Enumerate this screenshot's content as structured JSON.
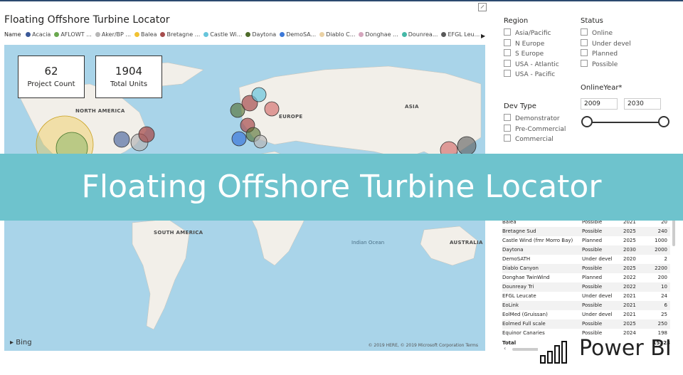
{
  "report": {
    "title": "Floating Offshore Turbine Locator",
    "legend_label": "Name",
    "legend_items": [
      {
        "label": "Acacia",
        "color": "#3b5998"
      },
      {
        "label": "AFLOWT ...",
        "color": "#6aa84f"
      },
      {
        "label": "Aker/BP ...",
        "color": "#b7b7b7"
      },
      {
        "label": "Balea",
        "color": "#f1c232"
      },
      {
        "label": "Bretagne ...",
        "color": "#a64d4d"
      },
      {
        "label": "Castle Wi...",
        "color": "#67c5db"
      },
      {
        "label": "Daytona",
        "color": "#4e6b2a"
      },
      {
        "label": "DemoSA...",
        "color": "#3c78d8"
      },
      {
        "label": "Diablo C...",
        "color": "#ead1a4"
      },
      {
        "label": "Donghae ...",
        "color": "#d5a6bd"
      },
      {
        "label": "Dounrea...",
        "color": "#45b8a7"
      },
      {
        "label": "EFGL Leu...",
        "color": "#595959"
      }
    ],
    "legend_more_icon": "chevron-right-icon",
    "focus_icon": "focus-mode-icon"
  },
  "cards": {
    "project_count": {
      "value": "62",
      "label": "Project Count"
    },
    "total_units": {
      "value": "1904",
      "label": "Total Units"
    }
  },
  "map": {
    "labels": {
      "north_america": "NORTH AMERICA",
      "europe": "EUROPE",
      "asia": "ASIA",
      "south_america": "SOUTH AMERICA",
      "australia": "AUSTRALIA",
      "indian_ocean": "Indian Ocean"
    },
    "bing": "Bing",
    "copyright": "© 2019 HERE, © 2019 Microsoft Corporation  Terms"
  },
  "slicers": {
    "region": {
      "title": "Region",
      "options": [
        "Asia/Pacific",
        "N Europe",
        "S Europe",
        "USA - Atlantic",
        "USA - Pacific"
      ]
    },
    "status": {
      "title": "Status",
      "options": [
        "Online",
        "Under devel",
        "Planned",
        "Possible"
      ]
    },
    "dev_type": {
      "title": "Dev Type",
      "options": [
        "Demonstrator",
        "Pre-Commercial",
        "Commercial"
      ]
    },
    "online_year": {
      "title": "OnlineYear*",
      "from": "2009",
      "to": "2030"
    }
  },
  "table": {
    "rows": [
      [
        "Balea",
        "Possible",
        "2021",
        "20"
      ],
      [
        "Bretagne Sud",
        "Possible",
        "2025",
        "240"
      ],
      [
        "Castle Wind (fmr Morro Bay)",
        "Planned",
        "2025",
        "1000"
      ],
      [
        "Daytona",
        "Possible",
        "2030",
        "2000"
      ],
      [
        "DemoSATH",
        "Under devel",
        "2020",
        "2"
      ],
      [
        "Diablo Canyon",
        "Possible",
        "2025",
        "2200"
      ],
      [
        "Donghae TwinWind",
        "Planned",
        "2022",
        "200"
      ],
      [
        "Dounreay Tri",
        "Possible",
        "2022",
        "10"
      ],
      [
        "EFGL Leucate",
        "Under devel",
        "2021",
        "24"
      ],
      [
        "EoLink",
        "Possible",
        "2021",
        "6"
      ],
      [
        "EolMed (Gruissan)",
        "Under devel",
        "2021",
        "25"
      ],
      [
        "Eolmed Full scale",
        "Possible",
        "2025",
        "250"
      ],
      [
        "Equinor Canaries",
        "Possible",
        "2024",
        "198"
      ]
    ],
    "total_label": "Total",
    "total_value": "15323"
  },
  "banner": {
    "text": "Floating Offshore Turbine Locator"
  },
  "branding": {
    "text": "Power BI"
  }
}
